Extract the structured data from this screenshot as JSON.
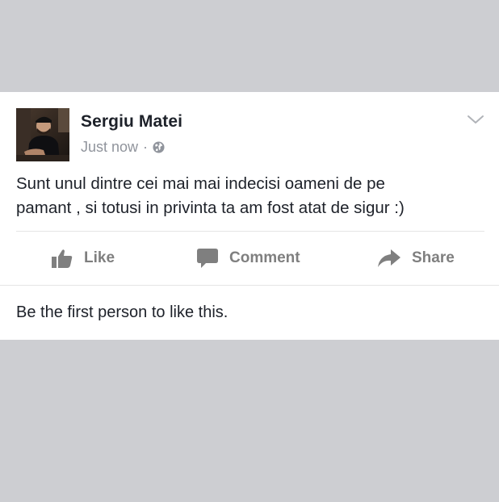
{
  "post": {
    "author_name": "Sergiu Matei",
    "timestamp": "Just now",
    "separator": "·",
    "privacy_icon": "globe-icon",
    "menu_icon": "chevron-down-icon",
    "body_line1": "Sunt unul dintre cei mai mai indecisi oameni de pe",
    "body_line2": "pamant , si totusi in privinta ta am fost atat de sigur :)"
  },
  "actions": {
    "like_label": "Like",
    "comment_label": "Comment",
    "share_label": "Share"
  },
  "likes_summary": "Be the first person to like this.",
  "colors": {
    "page_background": "#cdced2",
    "card_background": "#ffffff",
    "primary_text": "#1d2129",
    "secondary_text": "#90949c",
    "action_gray": "#7f7f7f"
  }
}
